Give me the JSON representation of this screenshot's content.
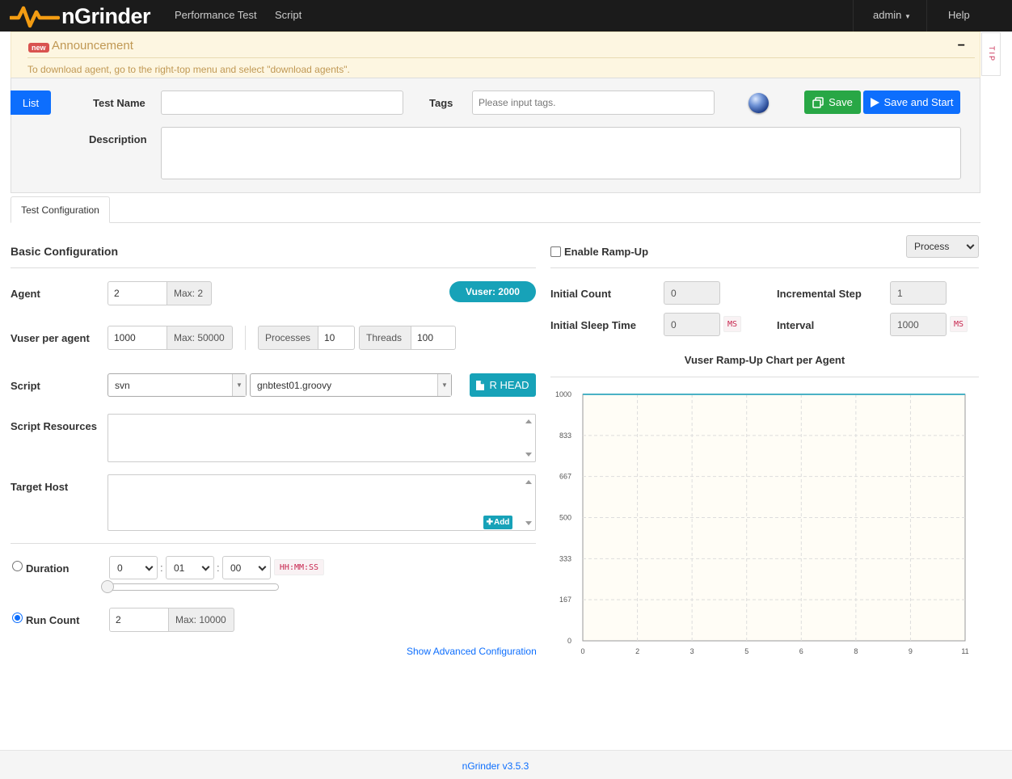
{
  "nav": {
    "brand": "nGrinder",
    "items": [
      "Performance Test",
      "Script"
    ],
    "user": "admin",
    "help": "Help"
  },
  "announcement": {
    "badge": "new",
    "title": "Announcement",
    "text": "To download agent, go to the right-top menu and select \"download agents\".",
    "toggle": "−",
    "tip": "TIP"
  },
  "header": {
    "list_button": "List",
    "test_name_label": "Test Name",
    "test_name_value": "",
    "tags_label": "Tags",
    "tags_placeholder": "Please input tags.",
    "save_button": "Save",
    "save_start_button": "Save and Start",
    "description_label": "Description",
    "description_value": ""
  },
  "tabs": [
    "Test Configuration"
  ],
  "basic": {
    "title": "Basic Configuration",
    "agent_label": "Agent",
    "agent_value": "2",
    "agent_max": "Max: 2",
    "vuser_badge": "Vuser: 2000",
    "vuser_per_agent_label": "Vuser per agent",
    "vuser_per_agent_value": "1000",
    "vuser_per_agent_max": "Max: 50000",
    "processes_label": "Processes",
    "processes_value": "10",
    "threads_label": "Threads",
    "threads_value": "100",
    "script_label": "Script",
    "script_repo": "svn",
    "script_file": "gnbtest01.groovy",
    "rhead_button": "R HEAD",
    "script_resources_label": "Script Resources",
    "target_host_label": "Target Host",
    "add_button": "Add",
    "duration_label": "Duration",
    "duration_hours": "0",
    "duration_minutes": "01",
    "duration_seconds": "00",
    "duration_format": "HH:MM:SS",
    "duration_selected": false,
    "run_count_label": "Run Count",
    "run_count_value": "2",
    "run_count_max": "Max: 10000",
    "run_count_selected": true,
    "advanced_link": "Show Advanced Configuration"
  },
  "rampup": {
    "enable_label": "Enable Ramp-Up",
    "enabled": false,
    "type_select": "Process",
    "initial_count_label": "Initial Count",
    "initial_count_value": "0",
    "incremental_step_label": "Incremental Step",
    "incremental_step_value": "1",
    "initial_sleep_label": "Initial Sleep Time",
    "initial_sleep_value": "0",
    "initial_sleep_unit": "MS",
    "interval_label": "Interval",
    "interval_value": "1000",
    "interval_unit": "MS"
  },
  "chart_data": {
    "type": "line",
    "title": "Vuser Ramp-Up Chart per Agent",
    "x_ticks": [
      "0",
      "2",
      "3",
      "5",
      "6",
      "8",
      "9",
      "11"
    ],
    "y_ticks": [
      "0",
      "167",
      "333",
      "500",
      "667",
      "833",
      "1000"
    ],
    "ylim": [
      0,
      1000
    ],
    "xlim": [
      0,
      11
    ],
    "series": [
      {
        "x": [
          0,
          11
        ],
        "y": [
          1000,
          1000
        ]
      }
    ],
    "line_color": "#4bb2c5",
    "background": "#fffdf6",
    "grid": true
  },
  "footer": {
    "version": "nGrinder v3.5.3"
  }
}
